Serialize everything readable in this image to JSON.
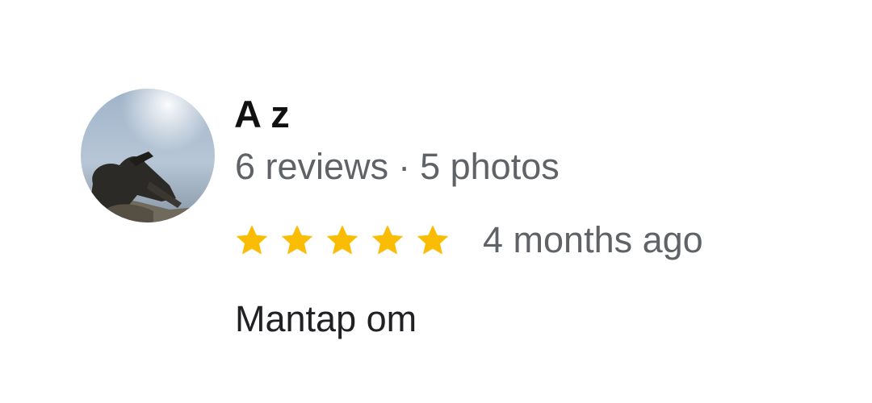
{
  "review": {
    "reviewer_name": "A z",
    "reviews_count": "6 reviews",
    "separator": "·",
    "photos_count": "5 photos",
    "rating": 5,
    "rating_max": 5,
    "star_icon": "star-icon",
    "star_color": "#fbbc04",
    "time_ago": "4 months ago",
    "text": "Mantap om",
    "avatar_icon": "reviewer-avatar-photo"
  }
}
